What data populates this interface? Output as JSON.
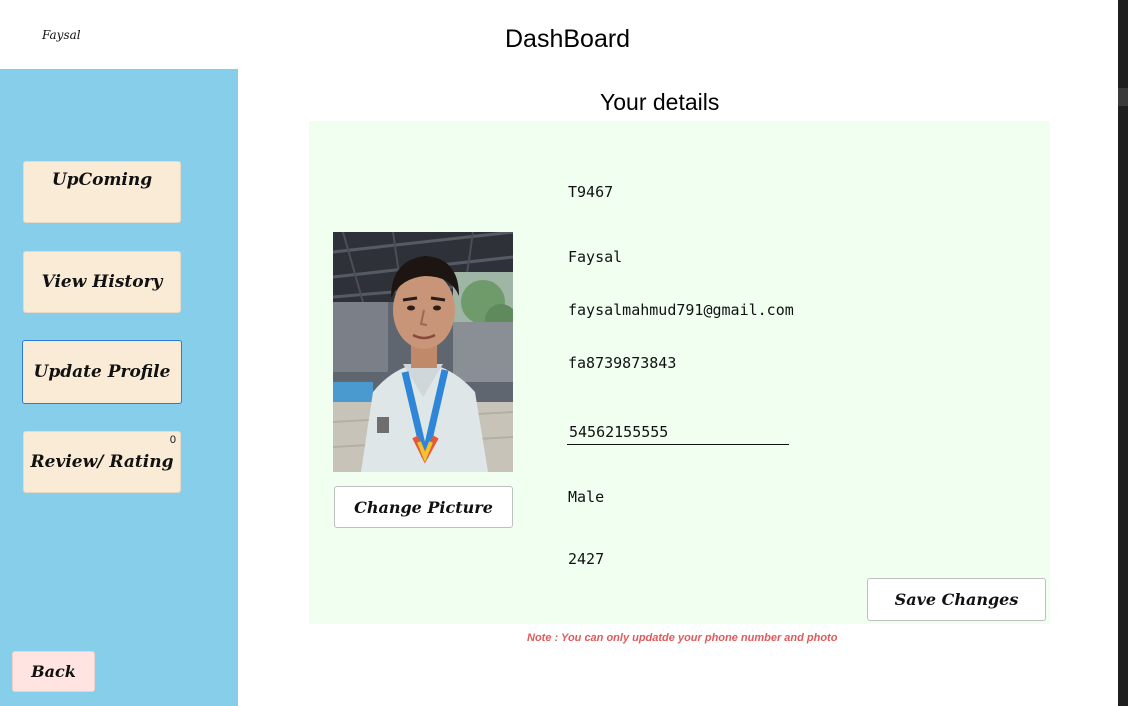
{
  "header": {
    "username": "Faysal",
    "title": "DashBoard"
  },
  "sidebar": {
    "buttons": {
      "upcoming": "UpComing",
      "view_history": "View History",
      "update_profile": "Update Profile",
      "review_rating": "Review/ Rating",
      "review_badge": "0",
      "back": "Back"
    }
  },
  "main": {
    "section_title": "Your details",
    "change_picture_label": "Change Picture",
    "save_changes_label": "Save Changes",
    "note": "Note : You can only updatde your phone number and photo"
  },
  "details": {
    "user_id": "T9467",
    "name": "Faysal",
    "email": "faysalmahmud791@gmail.com",
    "password": "fa8739873843",
    "phone": "54562155555",
    "gender": "Male",
    "code": "2427"
  },
  "colors": {
    "sidebar_bg": "#87ceeb",
    "nav_button_bg": "#faebd7",
    "back_button_bg": "#ffe4e1",
    "details_panel_bg": "#f0fff0",
    "active_border": "#2a7ad6",
    "note_text": "#e05a5a"
  },
  "icons": {
    "profile_photo": "profile-photo"
  }
}
